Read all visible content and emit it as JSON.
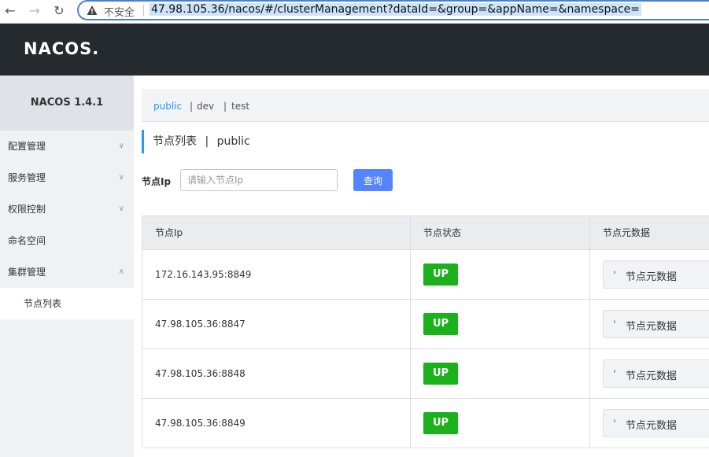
{
  "browser": {
    "back_icon": "←",
    "forward_icon": "→",
    "reload_icon": "↻",
    "insecure_label": "不安全",
    "url": "47.98.105.36/nacos/#/clusterManagement?dataId=&group=&appName=&namespace="
  },
  "header": {
    "logo": "NACOS."
  },
  "sidebar": {
    "title": "NACOS 1.4.1",
    "items": [
      {
        "label": "配置管理",
        "chevron": "∨"
      },
      {
        "label": "服务管理",
        "chevron": "∨"
      },
      {
        "label": "权限控制",
        "chevron": "∨"
      },
      {
        "label": "命名空间",
        "chevron": ""
      },
      {
        "label": "集群管理",
        "chevron": "∧"
      }
    ],
    "sub_items": [
      {
        "label": "节点列表"
      }
    ]
  },
  "namespaces": {
    "items": [
      "public",
      "dev",
      "test"
    ],
    "active": "public",
    "separator": "|"
  },
  "page": {
    "title": "节点列表",
    "separator": "|",
    "namespace": "public"
  },
  "filter": {
    "label": "节点Ip",
    "placeholder": "请输入节点Ip",
    "button": "查询"
  },
  "table": {
    "columns": [
      "节点Ip",
      "节点状态",
      "节点元数据"
    ],
    "meta_caret": "›",
    "rows": [
      {
        "ip": "172.16.143.95:8849",
        "status": "UP",
        "meta": "节点元数据"
      },
      {
        "ip": "47.98.105.36:8847",
        "status": "UP",
        "meta": "节点元数据"
      },
      {
        "ip": "47.98.105.36:8848",
        "status": "UP",
        "meta": "节点元数据"
      },
      {
        "ip": "47.98.105.36:8849",
        "status": "UP",
        "meta": "节点元数据"
      }
    ]
  }
}
